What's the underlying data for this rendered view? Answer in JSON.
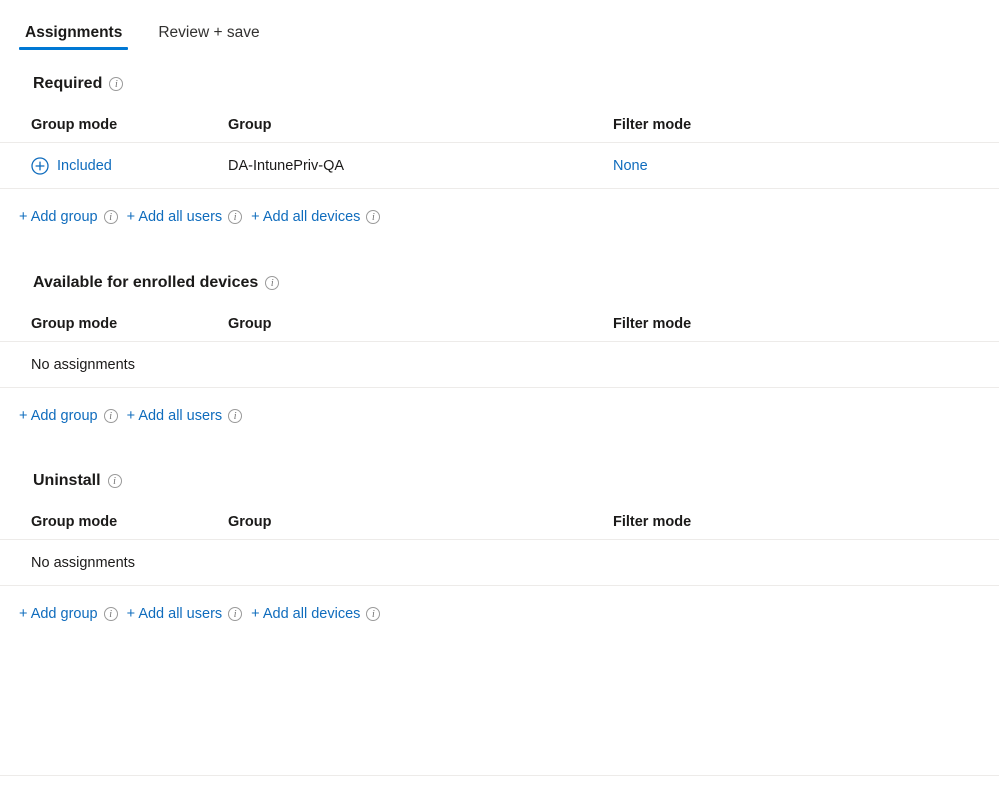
{
  "tabs": [
    {
      "label": "Assignments",
      "active": true
    },
    {
      "label": "Review + save",
      "active": false
    }
  ],
  "colors": {
    "accent": "#0078d4",
    "link": "#0f6cbd",
    "text": "#1b1a19",
    "divider": "#edebe9"
  },
  "columns": {
    "group_mode": "Group mode",
    "group": "Group",
    "filter_mode": "Filter mode"
  },
  "icons": {
    "info": "info-icon",
    "plus_circle": "plus-circle-icon"
  },
  "sections": [
    {
      "title": "Required",
      "rows": [
        {
          "group_mode": "Included",
          "group": "DA-IntunePriv-QA",
          "filter_mode": "None",
          "has_plus_icon": true,
          "empty": false
        }
      ],
      "empty_text": "",
      "actions": [
        {
          "label": "+ Add group"
        },
        {
          "label": "+ Add all users"
        },
        {
          "label": "+ Add all devices"
        }
      ]
    },
    {
      "title": "Available for enrolled devices",
      "rows": [],
      "empty_text": "No assignments",
      "actions": [
        {
          "label": "+ Add group"
        },
        {
          "label": "+ Add all users"
        }
      ]
    },
    {
      "title": "Uninstall",
      "rows": [],
      "empty_text": "No assignments",
      "actions": [
        {
          "label": "+ Add group"
        },
        {
          "label": "+ Add all users"
        },
        {
          "label": "+ Add all devices"
        }
      ]
    }
  ]
}
